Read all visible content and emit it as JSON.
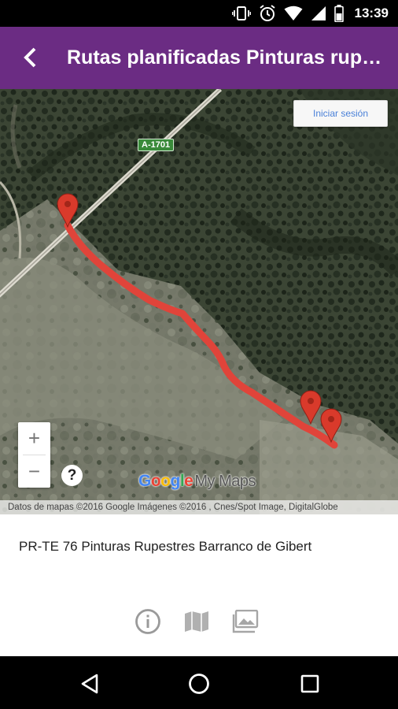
{
  "status_bar": {
    "time": "13:39",
    "icons": [
      "vibrate-icon",
      "alarm-icon",
      "wifi-icon",
      "signal-icon",
      "battery-icon"
    ]
  },
  "app_bar": {
    "title": "Rutas planificadas Pinturas rupestres",
    "back_icon": "chevron-left-icon",
    "color": "#6b2c83"
  },
  "map": {
    "login_label": "Iniciar sesión",
    "road_label": "A-1701",
    "zoom_in_label": "+",
    "zoom_out_label": "−",
    "help_label": "?",
    "logo": {
      "google": [
        "G",
        "o",
        "o",
        "g",
        "l",
        "e"
      ],
      "google_colors": [
        "#4285f4",
        "#ea4335",
        "#fbbc05",
        "#4285f4",
        "#34a853",
        "#ea4335"
      ],
      "suffix": "My Maps"
    },
    "attribution": "Datos de mapas ©2016 Google Imágenes ©2016 , Cnes/Spot Image, DigitalGlobe",
    "route_color": "#e0443a",
    "marker_color": "#d93a2b",
    "marker_count": 3
  },
  "info_panel": {
    "route_name": "PR-TE 76 Pinturas Rupestres Barranco de Gibert",
    "actions": [
      "info-icon",
      "map-icon",
      "gallery-icon"
    ]
  },
  "nav_bar": {
    "buttons": [
      "back-triangle-icon",
      "home-circle-icon",
      "recents-square-icon"
    ]
  }
}
